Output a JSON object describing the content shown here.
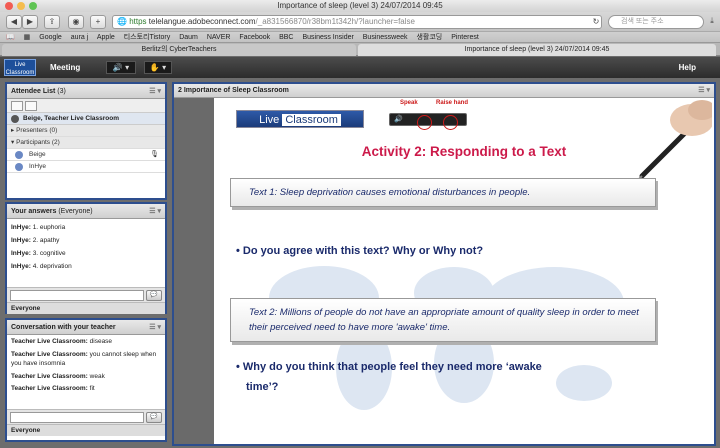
{
  "browser": {
    "window_title": "Importance of sleep (level 3) 24/07/2014 09:45",
    "url_https": "https",
    "url_host": "telelangue.adobeconnect.com",
    "url_path": "/_a831566870/r38bm1t342h/?launcher=false",
    "search_placeholder": "검색 또는 주소",
    "bookmarks": [
      "Google",
      "aura j",
      "Apple",
      "티스토리Tistory",
      "Daum",
      "NAVER",
      "Facebook",
      "BBC",
      "Business Insider",
      "Businessweek",
      "생활코딩",
      "Pinterest"
    ],
    "tabs": [
      "Berlitz의 CyberTeachers",
      "Importance of sleep (level 3) 24/07/2014 09:45"
    ]
  },
  "connect": {
    "logo": "Live Classroom",
    "meeting_menu": "Meeting",
    "help_menu": "Help"
  },
  "attendee": {
    "title": "Attendee List",
    "count": "(3)",
    "host": "Beige, Teacher Live Classroom",
    "presenters": "Presenters (0)",
    "participants": "Participants (2)",
    "people": [
      "Beige",
      "InHye"
    ]
  },
  "answers": {
    "title": "Your answers",
    "scope": "(Everyone)",
    "items": [
      {
        "name": "InHye:",
        "text": "1. euphoria"
      },
      {
        "name": "InHye:",
        "text": "2. apathy"
      },
      {
        "name": "InHye:",
        "text": "3. cognitive"
      },
      {
        "name": "InHye:",
        "text": "4. deprivation"
      }
    ],
    "audience": "Everyone"
  },
  "conversation": {
    "title": "Conversation with your teacher",
    "items": [
      {
        "name": "Teacher Live Classroom:",
        "text": "disease"
      },
      {
        "name": "Teacher Live Classroom:",
        "text": "you cannot sleep when you have insomnia"
      },
      {
        "name": "Teacher Live Classroom:",
        "text": "weak"
      },
      {
        "name": "Teacher Live Classroom:",
        "text": "fit"
      }
    ],
    "audience": "Everyone"
  },
  "share": {
    "title": "2 Importance of Sleep Classroom",
    "logo_left": "Live",
    "logo_right": "Classroom",
    "speak_label": "Speak",
    "raise_label": "Raise hand",
    "activity_title": "Activity 2: Responding to a Text",
    "text1": "Text 1: Sleep deprivation causes emotional disturbances in people.",
    "q1": "• Do you agree with this text?  Why or Why not?",
    "text2": "Text 2: Millions of people do not have an appropriate amount of quality sleep in order to meet their perceived need to have more 'awake' time.",
    "q2a": "• Why do you think that people feel they need more ‘awake",
    "q2b": "time’?"
  }
}
